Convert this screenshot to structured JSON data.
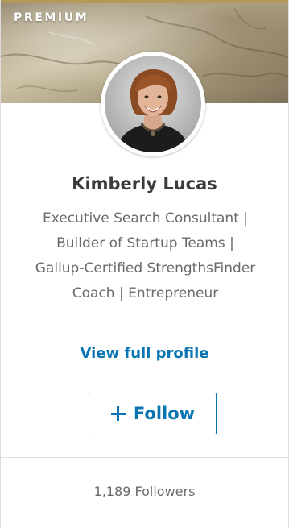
{
  "banner": {
    "badge_label": "PREMIUM"
  },
  "profile": {
    "name": "Kimberly Lucas",
    "headline": "Executive Search Consultant | Builder of Startup Teams | Gallup-Certified StrengthsFinder Coach | Entrepreneur",
    "view_profile_label": "View full profile"
  },
  "follow": {
    "icon": "plus-icon",
    "label": "Follow"
  },
  "stats": {
    "followers_text": "1,189 Followers"
  },
  "colors": {
    "link_blue": "#0a76b1",
    "name_text": "#3b3b3b",
    "secondary_text": "#6a6a6a",
    "premium_gold": "#b49a5a"
  }
}
